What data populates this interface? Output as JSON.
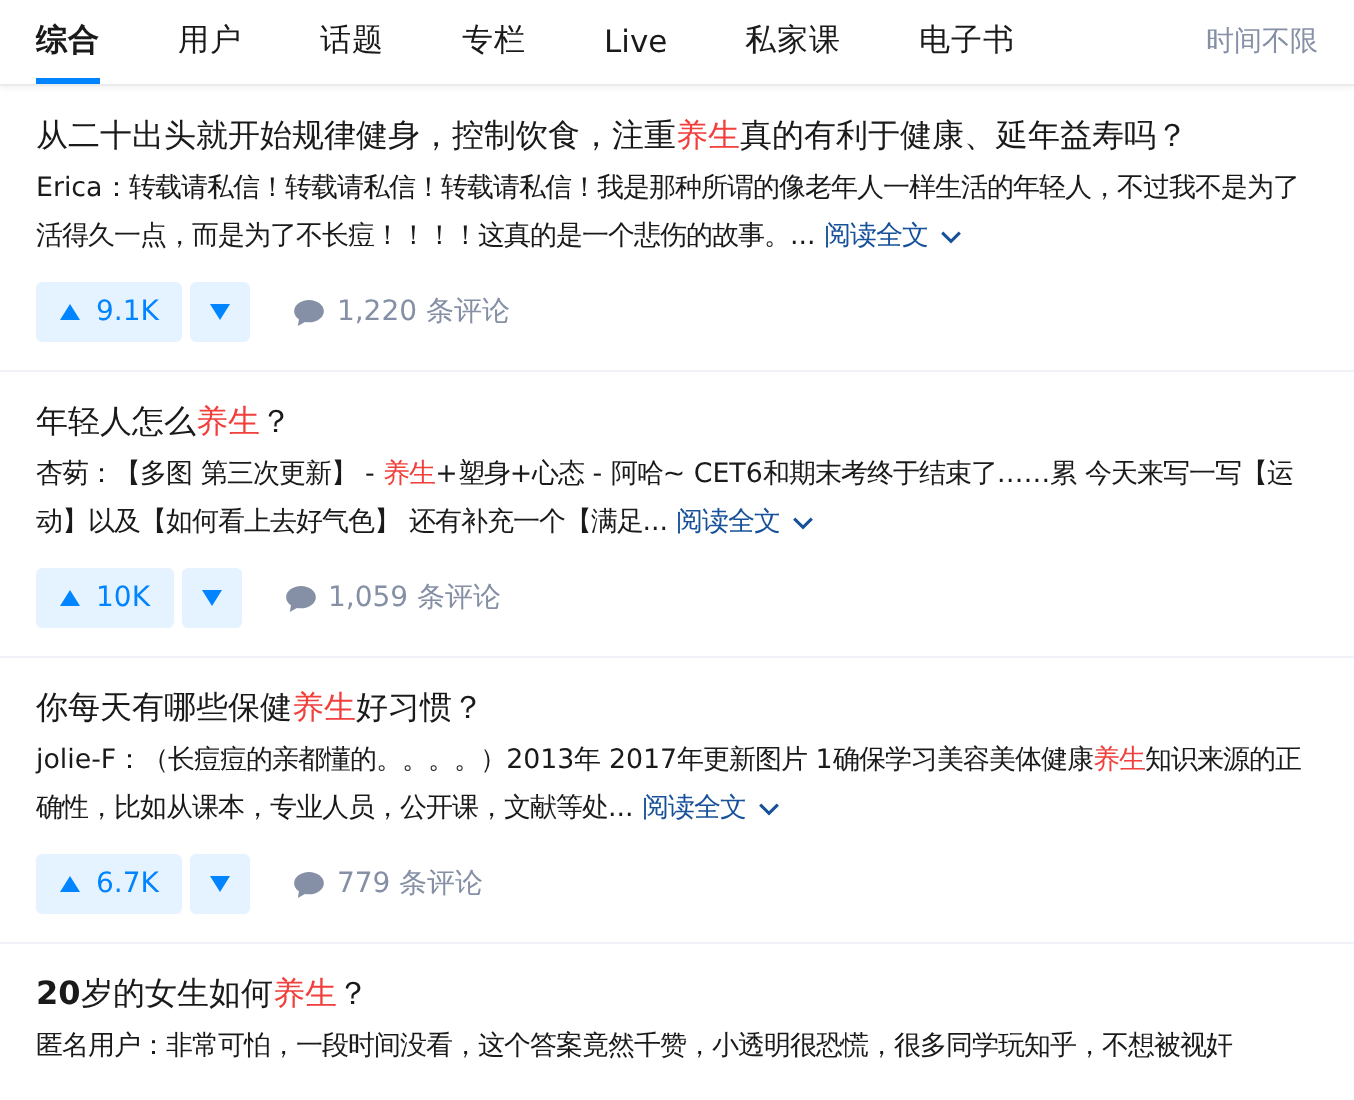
{
  "tabs": [
    {
      "label": "综合",
      "selected": true
    },
    {
      "label": "用户",
      "selected": false
    },
    {
      "label": "话题",
      "selected": false
    },
    {
      "label": "专栏",
      "selected": false
    },
    {
      "label": "Live",
      "selected": false
    },
    {
      "label": "私家课",
      "selected": false
    },
    {
      "label": "电子书",
      "selected": false
    }
  ],
  "time_filter": "时间不限",
  "results": [
    {
      "title": [
        {
          "text": "从二十出头就开始规律健身，控制饮食，注重",
          "highlight": false
        },
        {
          "text": "养生",
          "highlight": true
        },
        {
          "text": "真的有利于健康、延年益寿吗？",
          "highlight": false
        }
      ],
      "excerpt": [
        {
          "text": "Erica：转载请私信！转载请私信！转载请私信！我是那种所谓的像老年人一样生活的年轻人，不过我不是为了活得久一点，而是为了不长痘！！！！这真的是一个悲伤的故事。...",
          "highlight": false
        }
      ],
      "read_more": "阅读全文",
      "upvotes": "9.1K",
      "comments": "1,220 条评论"
    },
    {
      "title": [
        {
          "text": "年轻人怎么",
          "highlight": false
        },
        {
          "text": "养生",
          "highlight": true
        },
        {
          "text": "？",
          "highlight": false
        }
      ],
      "excerpt": [
        {
          "text": "杏茐：【多图 第三次更新】 - ",
          "highlight": false
        },
        {
          "text": "养生",
          "highlight": true
        },
        {
          "text": "+塑身+心态 - 阿哈~ CET6和期末考终于结束了……累 今天来写一写【运动】以及【如何看上去好气色】 还有补充一个【满足...",
          "highlight": false
        }
      ],
      "read_more": "阅读全文",
      "upvotes": "10K",
      "comments": "1,059 条评论"
    },
    {
      "title": [
        {
          "text": "你每天有哪些保健",
          "highlight": false
        },
        {
          "text": "养生",
          "highlight": true
        },
        {
          "text": "好习惯？",
          "highlight": false
        }
      ],
      "excerpt": [
        {
          "text": "jolie-F：（长痘痘的亲都懂的。。。。）2013年 2017年更新图片 1确保学习美容美体健康",
          "highlight": false
        },
        {
          "text": "养生",
          "highlight": true
        },
        {
          "text": "知识来源的正确性，比如从课本，专业人员，公开课，文献等处...",
          "highlight": false
        }
      ],
      "read_more": "阅读全文",
      "upvotes": "6.7K",
      "comments": "779 条评论"
    },
    {
      "title": [
        {
          "text": "**20**岁的女生如何",
          "highlight": false
        },
        {
          "text": "养生",
          "highlight": true
        },
        {
          "text": "？",
          "highlight": false
        }
      ],
      "excerpt": [
        {
          "text": "匿名用户：非常可怕，一段时间没看，这个答案竟然千赞，小透明很恐慌，很多同学玩知乎，不想被视奸",
          "highlight": false
        }
      ]
    }
  ]
}
